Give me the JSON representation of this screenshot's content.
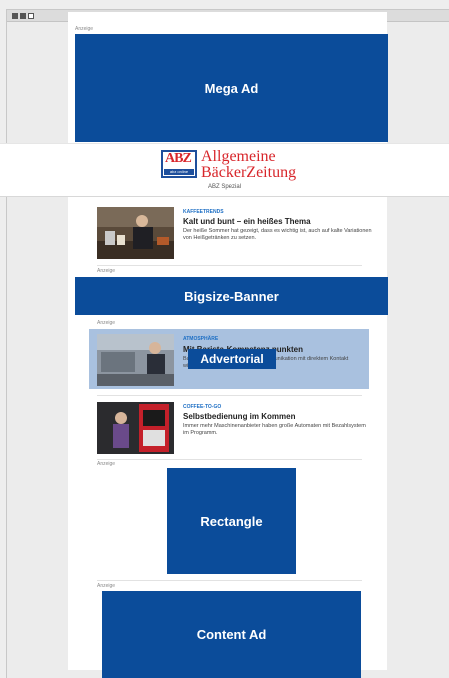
{
  "labels": {
    "anzeige": "Anzeige",
    "mega_ad": "Mega Ad",
    "bigsize_banner": "Bigsize-Banner",
    "advertorial": "Advertorial",
    "rectangle": "Rectangle",
    "content_ad": "Content Ad"
  },
  "masthead": {
    "logo_abbr": "ABZ",
    "logo_strip": "abz online",
    "title_line1": "Allgemeine",
    "title_line2": "BäckerZeitung",
    "subtitle": "ABZ Spezial"
  },
  "articles": [
    {
      "category": "KAFFEETRENDS",
      "headline": "Kalt und bunt – ein heißes Thema",
      "text": "Der heiße Sommer hat gezeigt, dass es wichtig ist, auch auf kalte Variationen von Heißgetränken zu setzen."
    },
    {
      "category": "ATMOSPHÄRE",
      "headline": "Mit Barista-Kompetenz punkten",
      "text": "Barista-Kompetenz und offene Kommunikation mit direktem Kontakt wichtig."
    },
    {
      "category": "COFFEE-TO-GO",
      "headline": "Selbstbedienung im Kommen",
      "text": "Immer mehr Maschinenanbieter haben große Automaten mit Bezahlsystem im Programm."
    }
  ],
  "colors": {
    "ad_blue": "#0b4c9a",
    "advertorial_overlay": "#a9c1df",
    "brand_red": "#d8262b",
    "category_blue": "#1e6fc4"
  }
}
